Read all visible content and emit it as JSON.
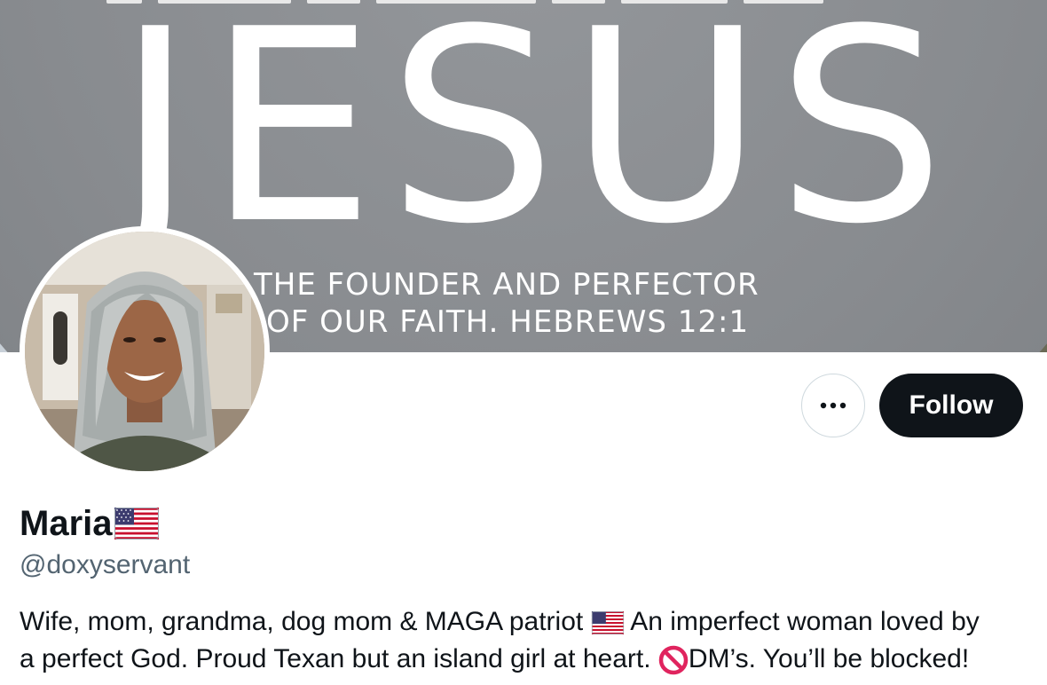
{
  "banner": {
    "title": "JESUS",
    "subtitle_line1": "THE FOUNDER AND PERFECTOR",
    "subtitle_line2": "OF OUR FAITH. HEBREWS 12:1"
  },
  "actions": {
    "more_label": "···",
    "follow_label": "Follow"
  },
  "profile": {
    "display_name": "Maria",
    "name_flag_icon": "us-flag-icon",
    "handle": "@doxyservant",
    "bio_part1": "Wife, mom, grandma, dog mom & MAGA patriot ",
    "bio_flag_icon": "us-flag-icon",
    "bio_part2": " An imperfect woman loved by",
    "bio_line2_part1": "a perfect God. Proud Texan but an island girl at heart. ",
    "bio_prohibited_icon": "prohibited-icon",
    "bio_line2_part2": "DM’s. You’ll be blocked!"
  },
  "colors": {
    "follow_bg": "#0f1419",
    "handle_text": "#536471",
    "border": "#cfd9de"
  }
}
